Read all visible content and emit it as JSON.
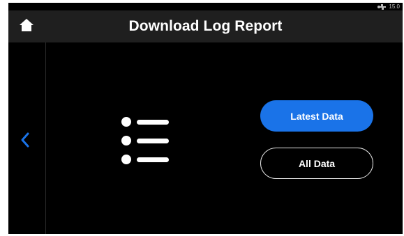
{
  "status_bar": {
    "icon": "usb-icon",
    "value": "15.0"
  },
  "header": {
    "title": "Download Log Report",
    "home_icon": "home-icon"
  },
  "nav": {
    "back_icon": "chevron-left-icon"
  },
  "content": {
    "icon": "list-icon"
  },
  "buttons": {
    "latest": "Latest Data",
    "all": "All Data"
  },
  "colors": {
    "accent": "#1a73e8",
    "background": "#000000",
    "header": "#1f1f1f",
    "text": "#ffffff"
  }
}
